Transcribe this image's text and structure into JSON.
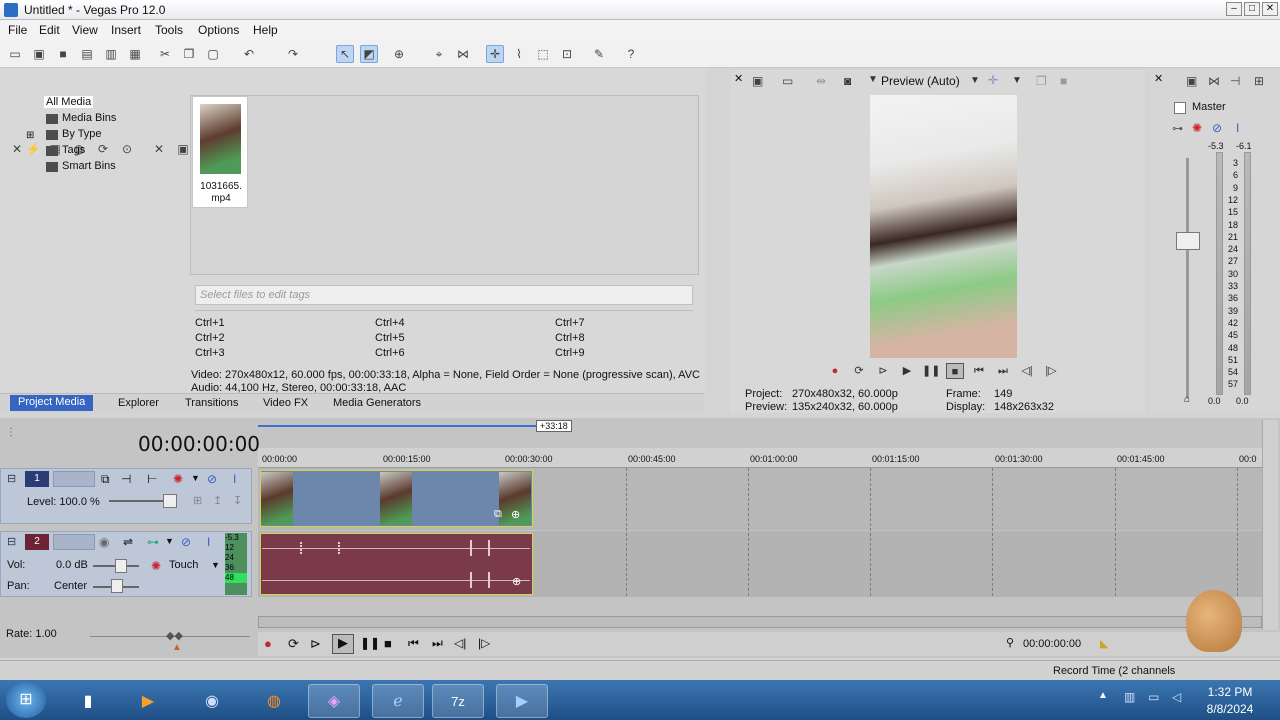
{
  "window": {
    "title": "Untitled * - Vegas Pro 12.0"
  },
  "menu": [
    "File",
    "Edit",
    "View",
    "Insert",
    "Tools",
    "Options",
    "Help"
  ],
  "explorer": {
    "tree": [
      "All Media",
      "Media Bins",
      "By Type",
      "Tags",
      "Smart Bins"
    ],
    "media_file": "1031665.\nmp4",
    "media_file_l1": "1031665.",
    "media_file_l2": "mp4",
    "tags_placeholder": "Select files to edit tags",
    "shortcuts": [
      "Ctrl+1",
      "Ctrl+4",
      "Ctrl+7",
      "Ctrl+2",
      "Ctrl+5",
      "Ctrl+8",
      "Ctrl+3",
      "Ctrl+6",
      "Ctrl+9"
    ],
    "info_video": "Video: 270x480x12, 60.000 fps, 00:00:33:18, Alpha = None, Field Order = None (progressive scan), AVC",
    "info_audio": "Audio: 44,100 Hz, Stereo, 00:00:33:18, AAC"
  },
  "tabs": [
    "Project Media",
    "Explorer",
    "Transitions",
    "Video FX",
    "Media Generators"
  ],
  "preview": {
    "mode": "Preview (Auto)",
    "project_label": "Project:",
    "project_value": "270x480x32, 60.000p",
    "preview_label": "Preview:",
    "preview_value": "135x240x32, 60.000p",
    "frame_label": "Frame:",
    "frame_value": "149",
    "display_label": "Display:",
    "display_value": "148x263x32"
  },
  "master": {
    "title": "Master",
    "peak_l": "-5.3",
    "peak_r": "-6.1",
    "scale": [
      "3",
      "6",
      "9",
      "12",
      "15",
      "18",
      "21",
      "24",
      "27",
      "30",
      "33",
      "36",
      "39",
      "42",
      "45",
      "48",
      "51",
      "54",
      "57"
    ],
    "bottom_l": "0.0",
    "bottom_r": "0.0"
  },
  "timeline": {
    "time": "00:00:00:00",
    "length_marker": "+33:18",
    "ruler": [
      "00:00:00",
      "00:00:15:00",
      "00:00:30:00",
      "00:00:45:00",
      "00:01:00:00",
      "00:01:15:00",
      "00:01:30:00",
      "00:01:45:00",
      "00:0"
    ],
    "video_track": {
      "number": "1",
      "level": "Level: 100.0 %"
    },
    "audio_track": {
      "number": "2",
      "vol_label": "Vol:",
      "vol_value": "0.0 dB",
      "pan_label": "Pan:",
      "pan_value": "Center",
      "mode": "Touch",
      "meter": [
        "-5.3",
        "12",
        "24",
        "36",
        "48"
      ]
    },
    "rate": "Rate: 1.00",
    "transport_time": "00:00:00:00",
    "record_time": "Record Time (2 channels"
  },
  "taskbar": {
    "time": "1:32 PM",
    "date": "8/8/2024"
  }
}
